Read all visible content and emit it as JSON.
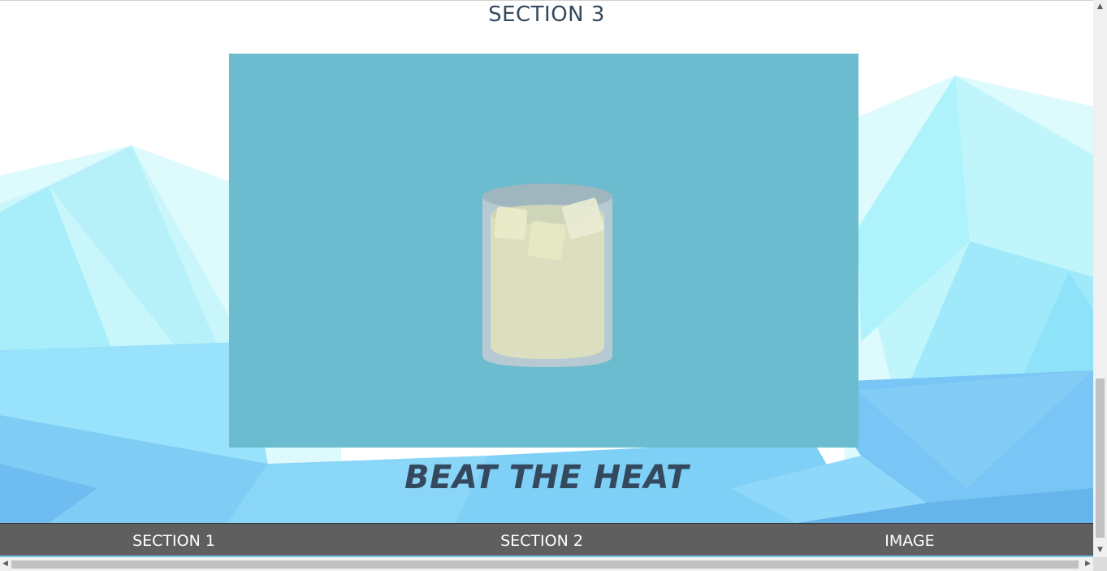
{
  "section": {
    "title": "SECTION 3"
  },
  "hero": {
    "headline": "BEAT THE HEAT"
  },
  "image": {
    "name": "iced-drink-glass-illustration"
  },
  "nav": {
    "items": [
      "SECTION 1",
      "SECTION 2",
      "IMAGE"
    ]
  },
  "colors": {
    "panel": "#6bbcce",
    "text": "#34495e",
    "nav_bg": "#5f5f5f",
    "nav_accent": "#74c7ea"
  },
  "scrollbars": {
    "up": "▲",
    "down": "▼",
    "left": "◀",
    "right": "▶"
  }
}
